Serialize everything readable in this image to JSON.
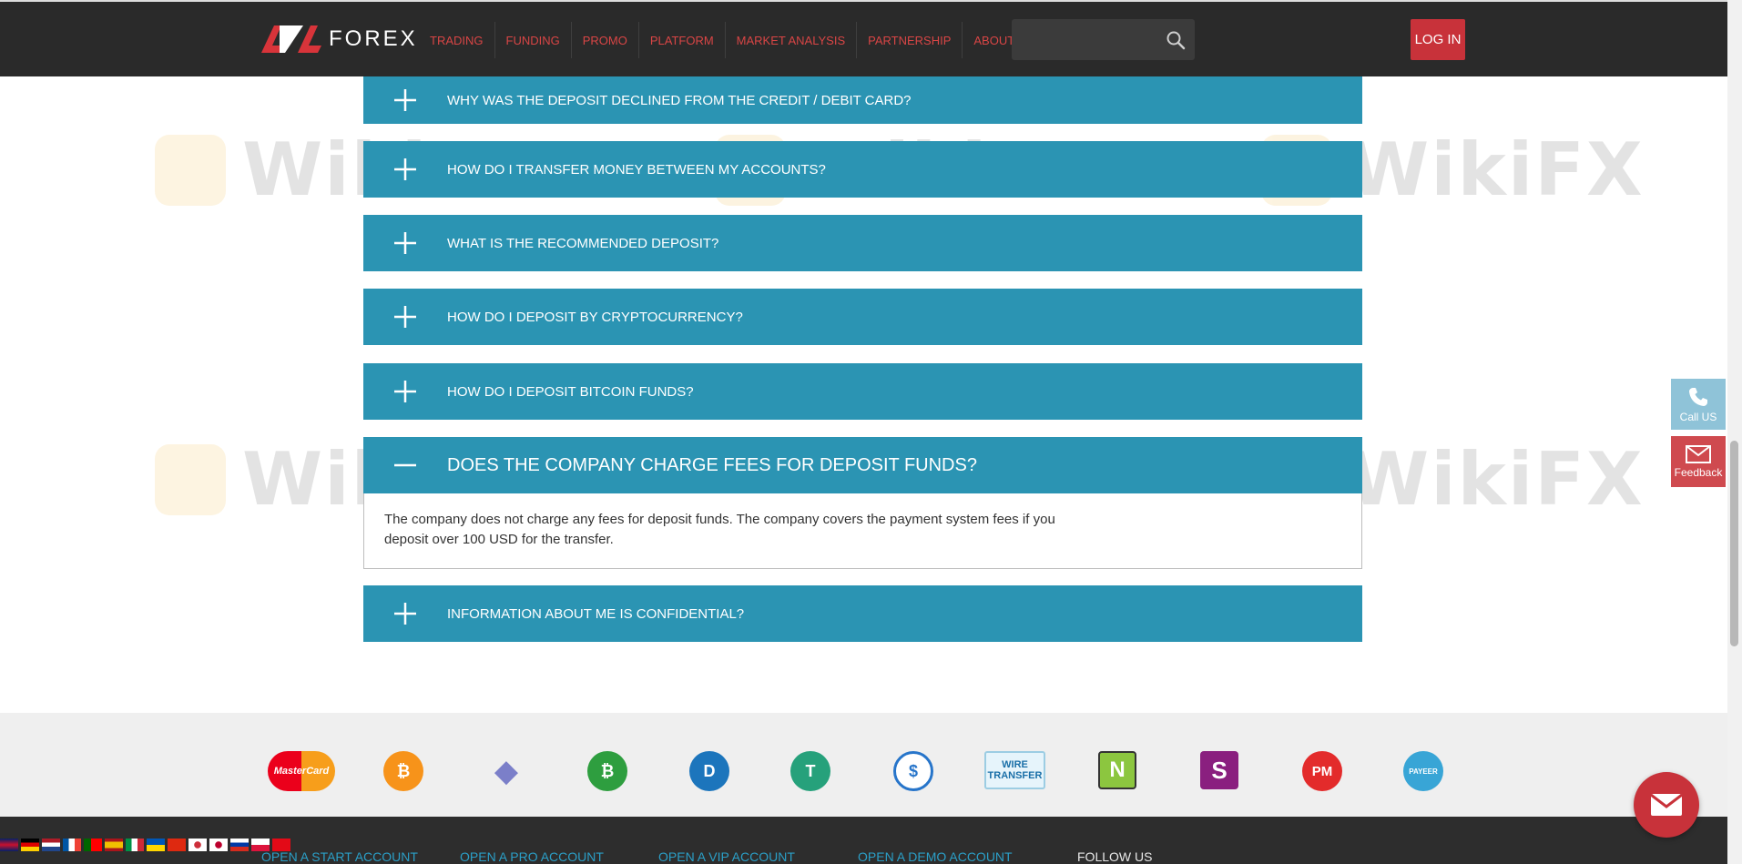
{
  "header": {
    "logo_text": "FOREX",
    "nav": [
      "TRADING",
      "FUNDING",
      "PROMO",
      "PLATFORM",
      "MARKET ANALYSIS",
      "PARTNERSHIP",
      "ABOUT"
    ],
    "search_placeholder": "",
    "login_label": "LOG IN"
  },
  "faq": [
    {
      "question": "WHY WAS THE DEPOSIT DECLINED FROM THE CREDIT / DEBIT CARD?",
      "open": false
    },
    {
      "question": "HOW DO I TRANSFER MONEY BETWEEN MY ACCOUNTS?",
      "open": false
    },
    {
      "question": "WHAT IS THE RECOMMENDED DEPOSIT?",
      "open": false
    },
    {
      "question": "HOW DO I DEPOSIT BY CRYPTOCURRENCY?",
      "open": false
    },
    {
      "question": "HOW DO I DEPOSIT BITCOIN FUNDS?",
      "open": false
    },
    {
      "question": "DOES THE COMPANY CHARGE FEES FOR DEPOSIT FUNDS?",
      "open": true,
      "answer": "The company does not charge any fees for deposit funds. The company covers the payment system fees if you deposit over 100 USD for the transfer."
    },
    {
      "question": "INFORMATION ABOUT ME IS CONFIDENTIAL?",
      "open": false
    }
  ],
  "watermark_text": "WikiFX",
  "side_widgets": {
    "call_label": "Call US",
    "feedback_label": "Feedback"
  },
  "payments": [
    {
      "name": "mastercard",
      "label": "MasterCard",
      "color": "#eb001b"
    },
    {
      "name": "bitcoin",
      "label": "₿",
      "color": "#f7931a"
    },
    {
      "name": "ethereum",
      "label": "◆",
      "color": "#7b7fc9"
    },
    {
      "name": "bitcoin-cash",
      "label": "₿",
      "color": "#2e9e3f"
    },
    {
      "name": "dash",
      "label": "D",
      "color": "#1c75bc"
    },
    {
      "name": "tether",
      "label": "T",
      "color": "#26a17b"
    },
    {
      "name": "usd-coin",
      "label": "$",
      "color": "#2775ca"
    },
    {
      "name": "wire-transfer",
      "label": "WIRE TRANSFER",
      "color": "#1a6fa8"
    },
    {
      "name": "neteller",
      "label": "N",
      "color": "#8cc63f"
    },
    {
      "name": "skrill",
      "label": "S",
      "color": "#8a1f7f"
    },
    {
      "name": "perfect-money",
      "label": "PM",
      "color": "#e32b2b"
    },
    {
      "name": "payeer",
      "label": "PAYEER",
      "color": "#38a5d6"
    }
  ],
  "footer": {
    "links": [
      "OPEN A START ACCOUNT",
      "OPEN A PRO ACCOUNT",
      "OPEN A VIP ACCOUNT",
      "OPEN A DEMO ACCOUNT"
    ],
    "follow_label": "FOLLOW US"
  },
  "colors": {
    "accent": "#2b94b3",
    "login": "#c8323a",
    "nav": "#d84545"
  }
}
